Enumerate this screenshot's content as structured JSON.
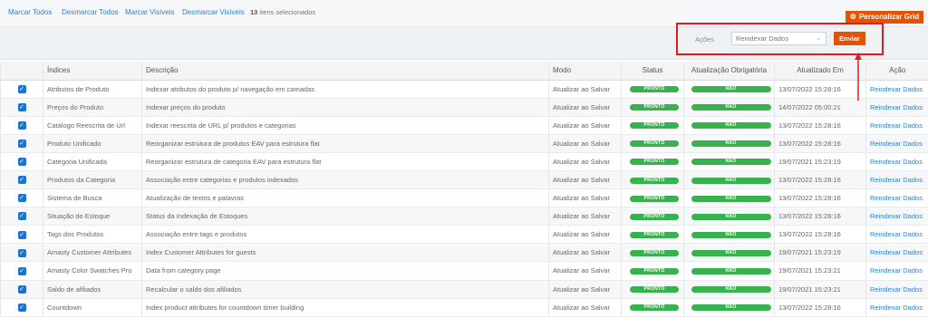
{
  "toolbar": {
    "customize_grid_label": "Personalizar Grid",
    "customize_icon": "gear-icon"
  },
  "massaction": {
    "select_all": "Marcar Todos",
    "unselect_all": "Desmarcar Todos",
    "select_visible": "Marcar Visíveis",
    "unselect_visible": "Desmarcar Visíveis",
    "selected_count": "13",
    "selected_suffix": " itens selecionados",
    "actions_label": "Ações",
    "actions_value": "Reindexar Dados",
    "submit_label": "Enviar"
  },
  "colors": {
    "accent": "#e35205",
    "link": "#2f7fd1",
    "success": "#37b24d",
    "annotation": "#e11b22"
  },
  "table": {
    "headers": [
      "Índices",
      "Descrição",
      "Modo",
      "Status",
      "Atualização Obrigatória",
      "Atualizado Em",
      "Ação"
    ],
    "rows": [
      {
        "index": "Atributos de Produto",
        "desc": "Indexar atributos do produto p/ navegação em camadas",
        "mode": "Atualizar ao Salvar",
        "status": "PRONTO",
        "required": "NÃO",
        "updated": "13/07/2022 15:28:16",
        "action": "Reindexar Dados"
      },
      {
        "index": "Preços do Produto",
        "desc": "Indexar preços do produto",
        "mode": "Atualizar ao Salvar",
        "status": "PRONTO",
        "required": "NÃO",
        "updated": "14/07/2022 05:00:21",
        "action": "Reindexar Dados"
      },
      {
        "index": "Catálogo Reescrita de Url",
        "desc": "Indexar reescrita de URL p/ produtos e categorias",
        "mode": "Atualizar ao Salvar",
        "status": "PRONTO",
        "required": "NÃO",
        "updated": "13/07/2022 15:28:16",
        "action": "Reindexar Dados"
      },
      {
        "index": "Produto Unificado",
        "desc": "Reorganizar estrutura de produtos EAV para estrutura flat",
        "mode": "Atualizar ao Salvar",
        "status": "PRONTO",
        "required": "NÃO",
        "updated": "13/07/2022 15:28:16",
        "action": "Reindexar Dados"
      },
      {
        "index": "Categoria Unificada",
        "desc": "Reorganizar estrutura de categoria EAV para estrutura flat",
        "mode": "Atualizar ao Salvar",
        "status": "PRONTO",
        "required": "NÃO",
        "updated": "19/07/2021 15:23:19",
        "action": "Reindexar Dados"
      },
      {
        "index": "Produtos da Categoria",
        "desc": "Associação entre categorias e produtos indexados",
        "mode": "Atualizar ao Salvar",
        "status": "PRONTO",
        "required": "NÃO",
        "updated": "13/07/2022 15:28:16",
        "action": "Reindexar Dados"
      },
      {
        "index": "Sistema de Busca",
        "desc": "Atualização de textos e palavras",
        "mode": "Atualizar ao Salvar",
        "status": "PRONTO",
        "required": "NÃO",
        "updated": "13/07/2022 15:28:16",
        "action": "Reindexar Dados"
      },
      {
        "index": "Situação do Estoque",
        "desc": "Status da Indexação de Estoques",
        "mode": "Atualizar ao Salvar",
        "status": "PRONTO",
        "required": "NÃO",
        "updated": "13/07/2022 15:28:16",
        "action": "Reindexar Dados"
      },
      {
        "index": "Tags dos Produtos",
        "desc": "Associação entre tags e produtos",
        "mode": "Atualizar ao Salvar",
        "status": "PRONTO",
        "required": "NÃO",
        "updated": "13/07/2022 15:28:16",
        "action": "Reindexar Dados"
      },
      {
        "index": "Amasty Customer Attributes",
        "desc": "Index Customer Attributes for guests",
        "mode": "Atualizar ao Salvar",
        "status": "PRONTO",
        "required": "NÃO",
        "updated": "19/07/2021 15:23:19",
        "action": "Reindexar Dados"
      },
      {
        "index": "Amasty Color Swatches Pro",
        "desc": "Data from category page",
        "mode": "Atualizar ao Salvar",
        "status": "PRONTO",
        "required": "NÃO",
        "updated": "19/07/2021 15:23:21",
        "action": "Reindexar Dados"
      },
      {
        "index": "Saldo de afiliados",
        "desc": "Recalcular o saldo dos afiliados",
        "mode": "Atualizar ao Salvar",
        "status": "PRONTO",
        "required": "NÃO",
        "updated": "19/07/2021 15:23:21",
        "action": "Reindexar Dados"
      },
      {
        "index": "Countdown",
        "desc": "Index product attributes for countdown timer building",
        "mode": "Atualizar ao Salvar",
        "status": "PRONTO",
        "required": "NÃO",
        "updated": "13/07/2022 15:28:16",
        "action": "Reindexar Dados"
      }
    ]
  }
}
